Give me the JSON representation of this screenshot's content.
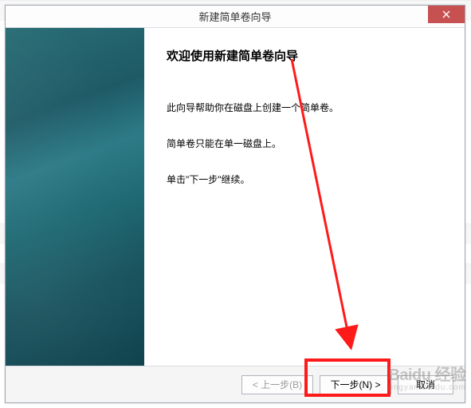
{
  "window": {
    "title": "新建简单卷向导",
    "close_icon": "close"
  },
  "wizard": {
    "heading": "欢迎使用新建简单卷向导",
    "line1": "此向导帮助你在磁盘上创建一个简单卷。",
    "line2": "简单卷只能在单一磁盘上。",
    "line3": "单击\"下一步\"继续。"
  },
  "buttons": {
    "back": "< 上一步(B)",
    "next": "下一步(N) >",
    "cancel": "取消"
  },
  "watermark": {
    "brand": "Baidu 经验",
    "url": "jingyan.baidu.com"
  }
}
